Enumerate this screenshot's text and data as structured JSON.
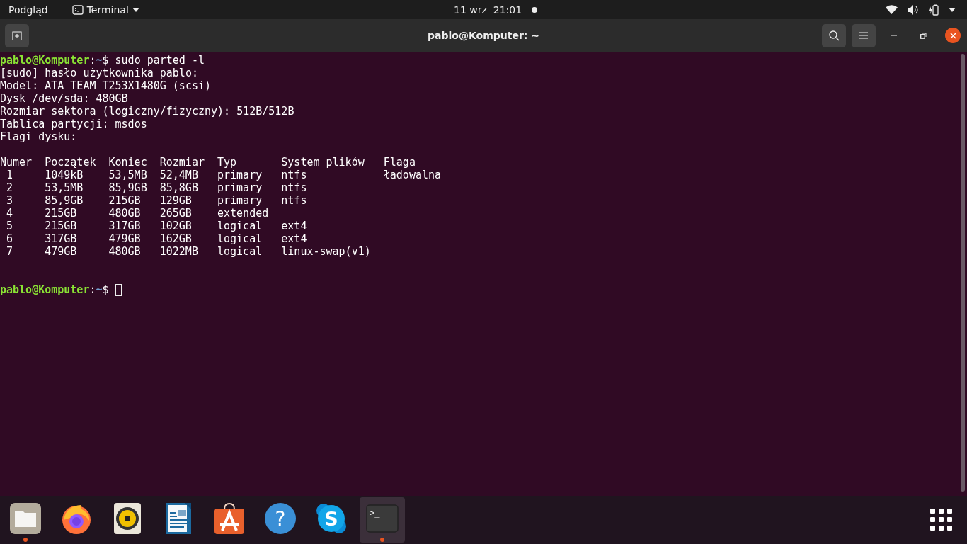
{
  "top_bar": {
    "activities": "Podgląd",
    "app_menu": "Terminal",
    "clock": "11 wrz  21:01",
    "notification_dot": true
  },
  "window": {
    "title": "pablo@Komputer: ~"
  },
  "terminal": {
    "prompt": {
      "user_host": "pablo@Komputer",
      "separator": ":",
      "path": "~",
      "symbol": "$",
      "command": " sudo parted -l"
    },
    "output": [
      "[sudo] hasło użytkownika pablo:",
      "Model: ATA TEAM T253X1480G (scsi)",
      "Dysk /dev/sda: 480GB",
      "Rozmiar sektora (logiczny/fizyczny): 512B/512B",
      "Tablica partycji: msdos",
      "Flagi dysku:"
    ],
    "table": {
      "columns": [
        "Numer",
        "Początek",
        "Koniec",
        "Rozmiar",
        "Typ",
        "System plików",
        "Flaga"
      ],
      "rows": [
        [
          "1",
          "1049kB",
          "53,5MB",
          "52,4MB",
          "primary",
          "ntfs",
          "ładowalna"
        ],
        [
          "2",
          "53,5MB",
          "85,9GB",
          "85,8GB",
          "primary",
          "ntfs",
          ""
        ],
        [
          "3",
          "85,9GB",
          "215GB",
          "129GB",
          "primary",
          "ntfs",
          ""
        ],
        [
          "4",
          "215GB",
          "480GB",
          "265GB",
          "extended",
          "",
          ""
        ],
        [
          "5",
          "215GB",
          "317GB",
          "102GB",
          "logical",
          "ext4",
          ""
        ],
        [
          "6",
          "317GB",
          "479GB",
          "162GB",
          "logical",
          "ext4",
          ""
        ],
        [
          "7",
          "479GB",
          "480GB",
          "1022MB",
          "logical",
          "linux-swap(v1)",
          ""
        ]
      ]
    },
    "final_prompt": {
      "user_host": "pablo@Komputer",
      "separator": ":",
      "path": "~",
      "symbol": "$"
    }
  },
  "dock": {
    "apps": [
      {
        "kind": "files",
        "running": true,
        "selected": false
      },
      {
        "kind": "firefox",
        "running": false,
        "selected": false
      },
      {
        "kind": "rhythmbox",
        "running": false,
        "selected": false
      },
      {
        "kind": "writer",
        "running": false,
        "selected": false
      },
      {
        "kind": "software",
        "running": false,
        "selected": false
      },
      {
        "kind": "help",
        "glyph": "?",
        "running": false,
        "selected": false
      },
      {
        "kind": "skype",
        "glyph": "S",
        "running": false,
        "selected": false
      },
      {
        "kind": "terminal",
        "glyph": ">_",
        "running": true,
        "selected": true
      }
    ]
  }
}
